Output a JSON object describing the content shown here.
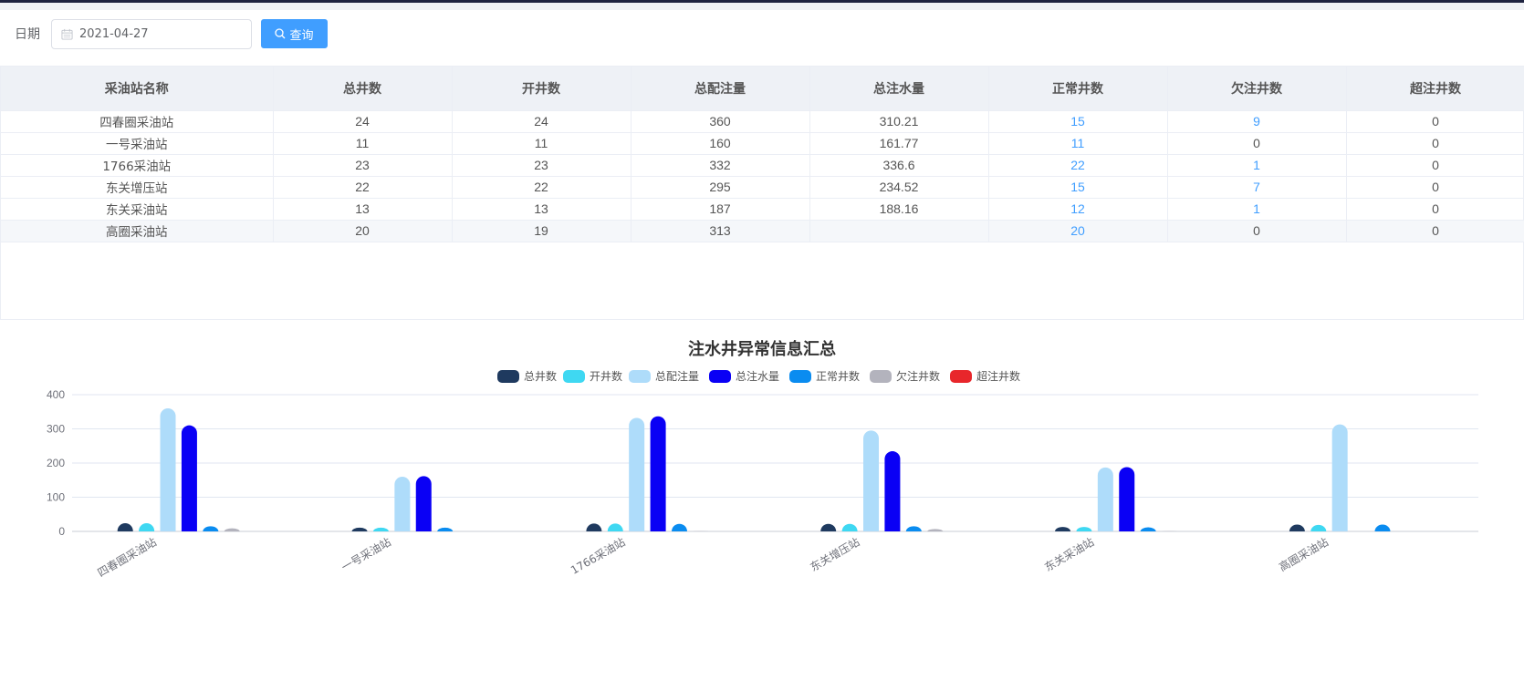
{
  "filter": {
    "label": "日期",
    "date_value": "2021-04-27",
    "query_label": "查询"
  },
  "table": {
    "columns": [
      "采油站名称",
      "总井数",
      "开井数",
      "总配注量",
      "总注水量",
      "正常井数",
      "欠注井数",
      "超注井数"
    ],
    "rows": [
      [
        "四春圈采油站",
        "24",
        "24",
        "360",
        "310.21",
        "15",
        "9",
        "0"
      ],
      [
        "一号采油站",
        "11",
        "11",
        "160",
        "161.77",
        "11",
        "0",
        "0"
      ],
      [
        "1766采油站",
        "23",
        "23",
        "332",
        "336.6",
        "22",
        "1",
        "0"
      ],
      [
        "东关增压站",
        "22",
        "22",
        "295",
        "234.52",
        "15",
        "7",
        "0"
      ],
      [
        "东关采油站",
        "13",
        "13",
        "187",
        "188.16",
        "12",
        "1",
        "0"
      ],
      [
        "高圈采油站",
        "20",
        "19",
        "313",
        "",
        "20",
        "0",
        "0"
      ]
    ]
  },
  "chart_data": {
    "type": "bar",
    "title": "注水井异常信息汇总",
    "categories": [
      "四春圈采油站",
      "一号采油站",
      "1766采油站",
      "东关增压站",
      "东关采油站",
      "高圈采油站"
    ],
    "ylim": [
      0,
      400
    ],
    "yticks": [
      "0",
      "100",
      "200",
      "300",
      "400"
    ],
    "legend_position": "top-center",
    "grid": true,
    "series": [
      {
        "name": "总井数",
        "color": "#1f3a5f",
        "values": [
          24,
          11,
          23,
          22,
          13,
          20
        ]
      },
      {
        "name": "开井数",
        "color": "#3fd8f2",
        "values": [
          24,
          11,
          23,
          22,
          13,
          19
        ]
      },
      {
        "name": "总配注量",
        "color": "#aedcfa",
        "values": [
          360,
          160,
          332,
          295,
          187,
          313
        ]
      },
      {
        "name": "总注水量",
        "color": "#0a00f5",
        "values": [
          310.21,
          161.77,
          336.6,
          234.52,
          188.16,
          0
        ]
      },
      {
        "name": "正常井数",
        "color": "#0a8cf0",
        "values": [
          15,
          11,
          22,
          15,
          12,
          20
        ]
      },
      {
        "name": "欠注井数",
        "color": "#b3b3bd",
        "values": [
          9,
          0,
          1,
          7,
          1,
          0
        ]
      },
      {
        "name": "超注井数",
        "color": "#e8262b",
        "values": [
          0,
          0,
          0,
          0,
          0,
          0
        ]
      }
    ]
  }
}
